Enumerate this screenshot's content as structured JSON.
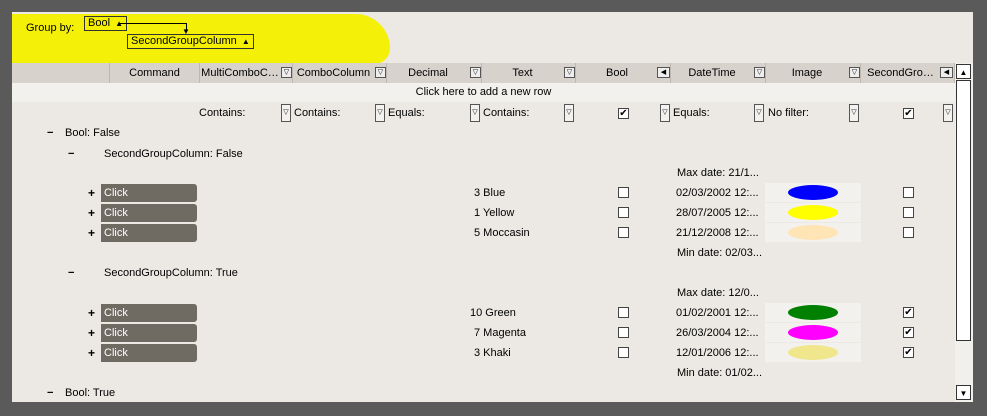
{
  "group_panel": {
    "label": "Group by:",
    "chips": [
      {
        "label": "Bool",
        "sort": "▲"
      },
      {
        "label": "SecondGroupColumn",
        "sort": "▲"
      }
    ]
  },
  "columns": [
    {
      "label": "Command",
      "filter_icon": "▽"
    },
    {
      "label": "MultiComboC…",
      "filter_icon": "▽"
    },
    {
      "label": "ComboColumn",
      "filter_icon": "▽"
    },
    {
      "label": "Decimal",
      "filter_icon": "▽"
    },
    {
      "label": "Text",
      "filter_icon": "▽"
    },
    {
      "label": "Bool",
      "filter_icon": "◀▽"
    },
    {
      "label": "DateTime",
      "filter_icon": "▽"
    },
    {
      "label": "Image",
      "filter_icon": "▽"
    },
    {
      "label": "SecondGro…",
      "filter_icon": "◀▽"
    }
  ],
  "add_row_text": "Click here to add a new row",
  "filter_row": {
    "multicombo": "Contains:",
    "combo": "Contains:",
    "decimal": "Equals:",
    "text": "Contains:",
    "bool_checked": true,
    "datetime": "Equals:",
    "image": "No filter:",
    "second_checked": true
  },
  "groups": {
    "bool_false": {
      "expander": "−",
      "label": "Bool: False"
    },
    "bool_true": {
      "expander": "−",
      "label": "Bool: True"
    },
    "second_false": {
      "expander": "−",
      "label": "SecondGroupColumn: False"
    },
    "second_true": {
      "expander": "−",
      "label": "SecondGroupColumn: True"
    }
  },
  "section_false": {
    "max_date": "Max date: 21/1...",
    "min_date": "Min date: 02/03...",
    "rows": [
      {
        "expander": "+",
        "command": "Click",
        "text": "3 Blue",
        "bool": false,
        "datetime": "02/03/2002  12:...",
        "color": "#0000ff",
        "second": false
      },
      {
        "expander": "+",
        "command": "Click",
        "text": "1 Yellow",
        "bool": false,
        "datetime": "28/07/2005  12:...",
        "color": "#ffff00",
        "second": false
      },
      {
        "expander": "+",
        "command": "Click",
        "text": "5 Moccasin",
        "bool": false,
        "datetime": "21/12/2008  12:...",
        "color": "#ffe4b5",
        "second": false
      }
    ]
  },
  "section_true": {
    "max_date": "Max date: 12/0...",
    "min_date": "Min date: 01/02...",
    "rows": [
      {
        "expander": "+",
        "command": "Click",
        "text": "10 Green",
        "bool": false,
        "datetime": "01/02/2001  12:...",
        "color": "#008000",
        "second": true
      },
      {
        "expander": "+",
        "command": "Click",
        "text": "7 Magenta",
        "bool": false,
        "datetime": "26/03/2004  12:...",
        "color": "#ff00ff",
        "second": true
      },
      {
        "expander": "+",
        "command": "Click",
        "text": "3 Khaki",
        "bool": false,
        "datetime": "12/01/2006  12:...",
        "color": "#f0e68c",
        "second": true
      }
    ]
  },
  "scrollbar": {
    "up": "▲",
    "down": "▼"
  }
}
